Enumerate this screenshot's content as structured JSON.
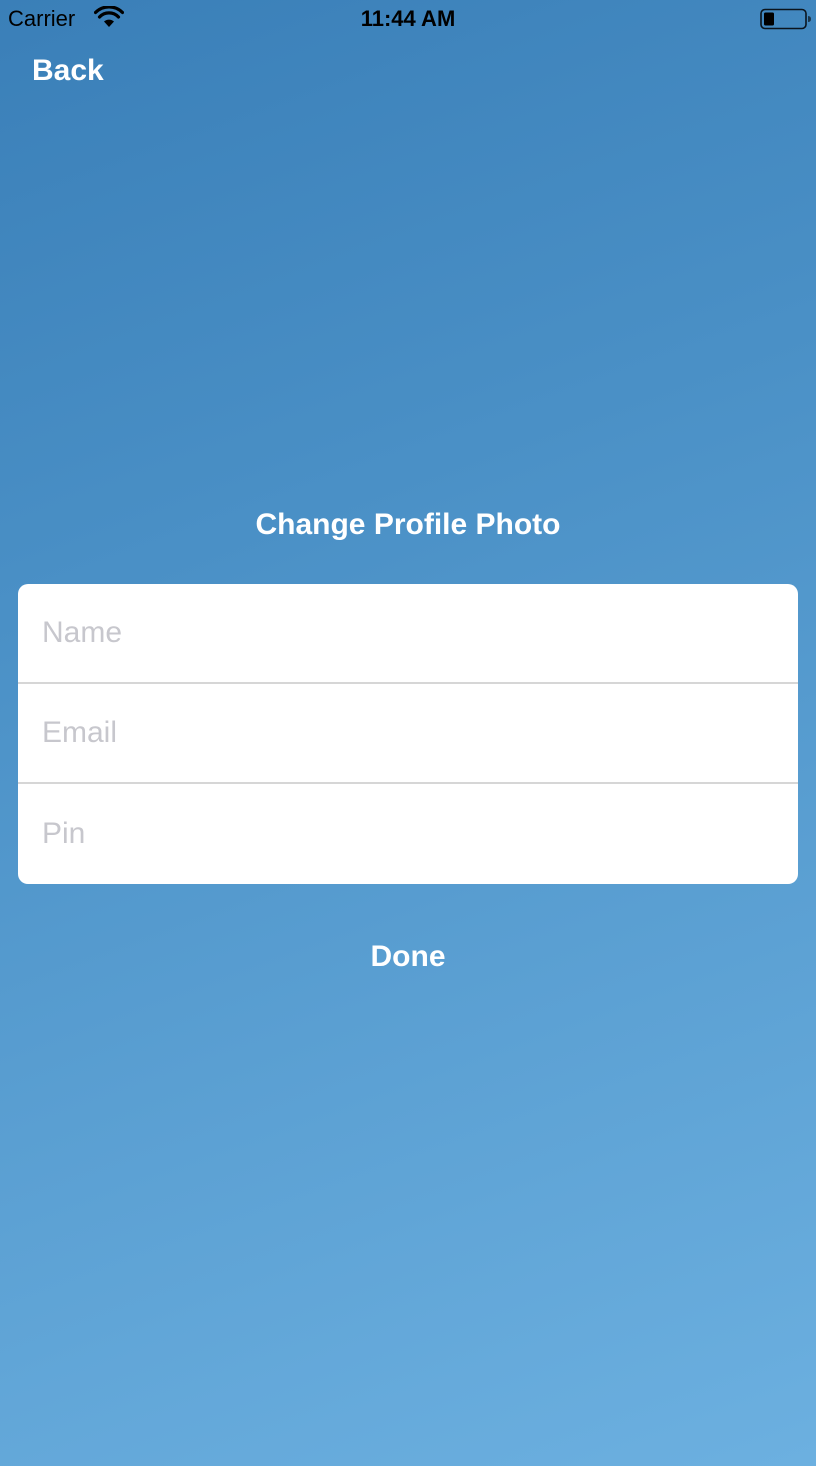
{
  "status_bar": {
    "carrier": "Carrier",
    "time": "11:44 AM",
    "wifi_icon": "wifi-icon",
    "battery_icon": "battery-icon"
  },
  "nav": {
    "back_label": "Back"
  },
  "profile": {
    "change_photo_label": "Change Profile Photo"
  },
  "form": {
    "name": {
      "placeholder": "Name",
      "value": ""
    },
    "email": {
      "placeholder": "Email",
      "value": ""
    },
    "pin": {
      "placeholder": "Pin",
      "value": ""
    }
  },
  "actions": {
    "done_label": "Done"
  },
  "colors": {
    "background_top": "#3a7fb8",
    "background_bottom": "#6cb0e0",
    "card": "#ffffff",
    "placeholder": "#c7c7cd",
    "divider": "#d6d6d6"
  }
}
